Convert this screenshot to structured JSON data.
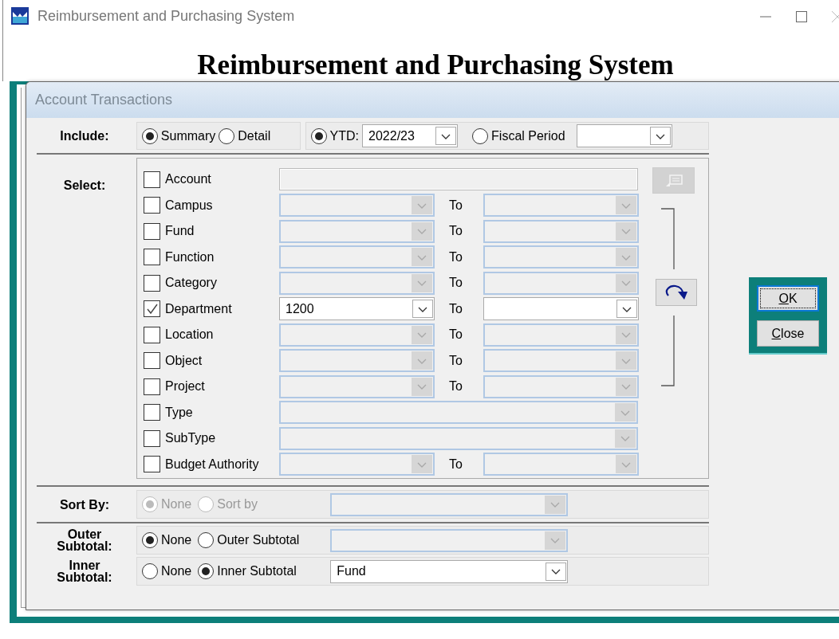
{
  "window": {
    "title": "Reimbursement and Purchasing System"
  },
  "heading": "Reimbursement and Purchasing System",
  "dialog": {
    "title": "Account Transactions",
    "include": {
      "label": "Include:",
      "options": [
        {
          "label": "Summary",
          "selected": true
        },
        {
          "label": "Detail",
          "selected": false
        }
      ],
      "periods": [
        {
          "label": "YTD:",
          "selected": true,
          "dropdown": {
            "value": "2022/23",
            "disabled": false
          }
        },
        {
          "label": "Fiscal Period",
          "selected": false,
          "dropdown": {
            "disabled": false
          }
        }
      ]
    },
    "select": {
      "label": "Select:",
      "rows": [
        {
          "kind": "text",
          "label": "Account",
          "checked": false
        },
        {
          "kind": "range",
          "label": "Campus",
          "checked": false,
          "to_label": "To"
        },
        {
          "kind": "range",
          "label": "Fund",
          "checked": false,
          "to_label": "To"
        },
        {
          "kind": "range",
          "label": "Function",
          "checked": false,
          "to_label": "To"
        },
        {
          "kind": "range",
          "label": "Category",
          "checked": false,
          "to_label": "To"
        },
        {
          "kind": "range",
          "label": "Department",
          "checked": true,
          "value": "1200",
          "to_label": "To"
        },
        {
          "kind": "range",
          "label": "Location",
          "checked": false,
          "to_label": "To"
        },
        {
          "kind": "range",
          "label": "Object",
          "checked": false,
          "to_label": "To"
        },
        {
          "kind": "range",
          "label": "Project",
          "checked": false,
          "to_label": "To"
        },
        {
          "kind": "single",
          "label": "Type",
          "checked": false
        },
        {
          "kind": "single",
          "label": "SubType",
          "checked": false
        },
        {
          "kind": "range",
          "label": "Budget Authority",
          "checked": false,
          "to_label": "To"
        }
      ],
      "tools": [
        {
          "kind": "report",
          "disabled": true
        },
        {
          "kind": "swap",
          "disabled": false
        }
      ]
    },
    "sort_by": {
      "label": "Sort By:",
      "disabled": true,
      "options": [
        {
          "label": "None",
          "selected": true
        },
        {
          "label": "Sort by",
          "selected": false
        }
      ]
    },
    "outer_subtotal": {
      "label": "Outer Subtotal:",
      "options": [
        {
          "label": "None",
          "selected": true
        },
        {
          "label": "Outer Subtotal",
          "selected": false
        }
      ],
      "dropdown": {
        "disabled": true
      }
    },
    "inner_subtotal": {
      "label": "Inner Subtotal:",
      "options": [
        {
          "label": "None",
          "selected": false
        },
        {
          "label": "Inner Subtotal",
          "selected": true
        }
      ],
      "dropdown": {
        "value": "Fund",
        "disabled": false
      }
    }
  },
  "buttons": [
    {
      "label": "OK",
      "focused": true
    },
    {
      "label": "Close",
      "focused": false
    }
  ]
}
